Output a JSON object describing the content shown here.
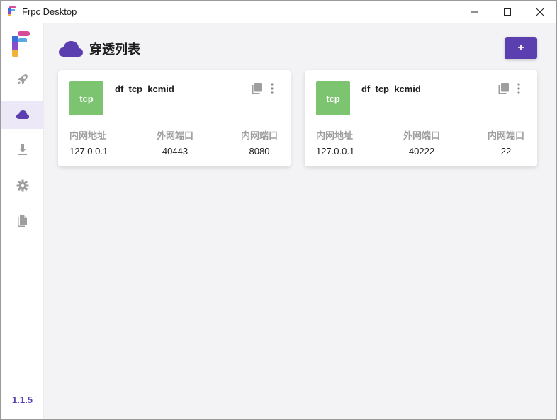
{
  "window": {
    "title": "Frpc Desktop"
  },
  "sidebar": {
    "items": [
      {
        "icon": "rocket-icon"
      },
      {
        "icon": "cloud-icon",
        "active": true
      },
      {
        "icon": "download-icon"
      },
      {
        "icon": "gear-icon"
      },
      {
        "icon": "copy-file-icon"
      }
    ],
    "version": "1.1.5"
  },
  "header": {
    "title": "穿透列表",
    "add_label": "+"
  },
  "colors": {
    "accent": "#5b3fb1",
    "badge": "#7cc46f",
    "background": "#f3f2f4"
  },
  "proxies": [
    {
      "type": "tcp",
      "name": "df_tcp_kcmid",
      "local_ip_label": "内网地址",
      "local_ip": "127.0.0.1",
      "remote_port_label": "外网端口",
      "remote_port": "40443",
      "local_port_label": "内网端口",
      "local_port": "8080"
    },
    {
      "type": "tcp",
      "name": "df_tcp_kcmid",
      "local_ip_label": "内网地址",
      "local_ip": "127.0.0.1",
      "remote_port_label": "外网端口",
      "remote_port": "40222",
      "local_port_label": "内网端口",
      "local_port": "22"
    }
  ]
}
